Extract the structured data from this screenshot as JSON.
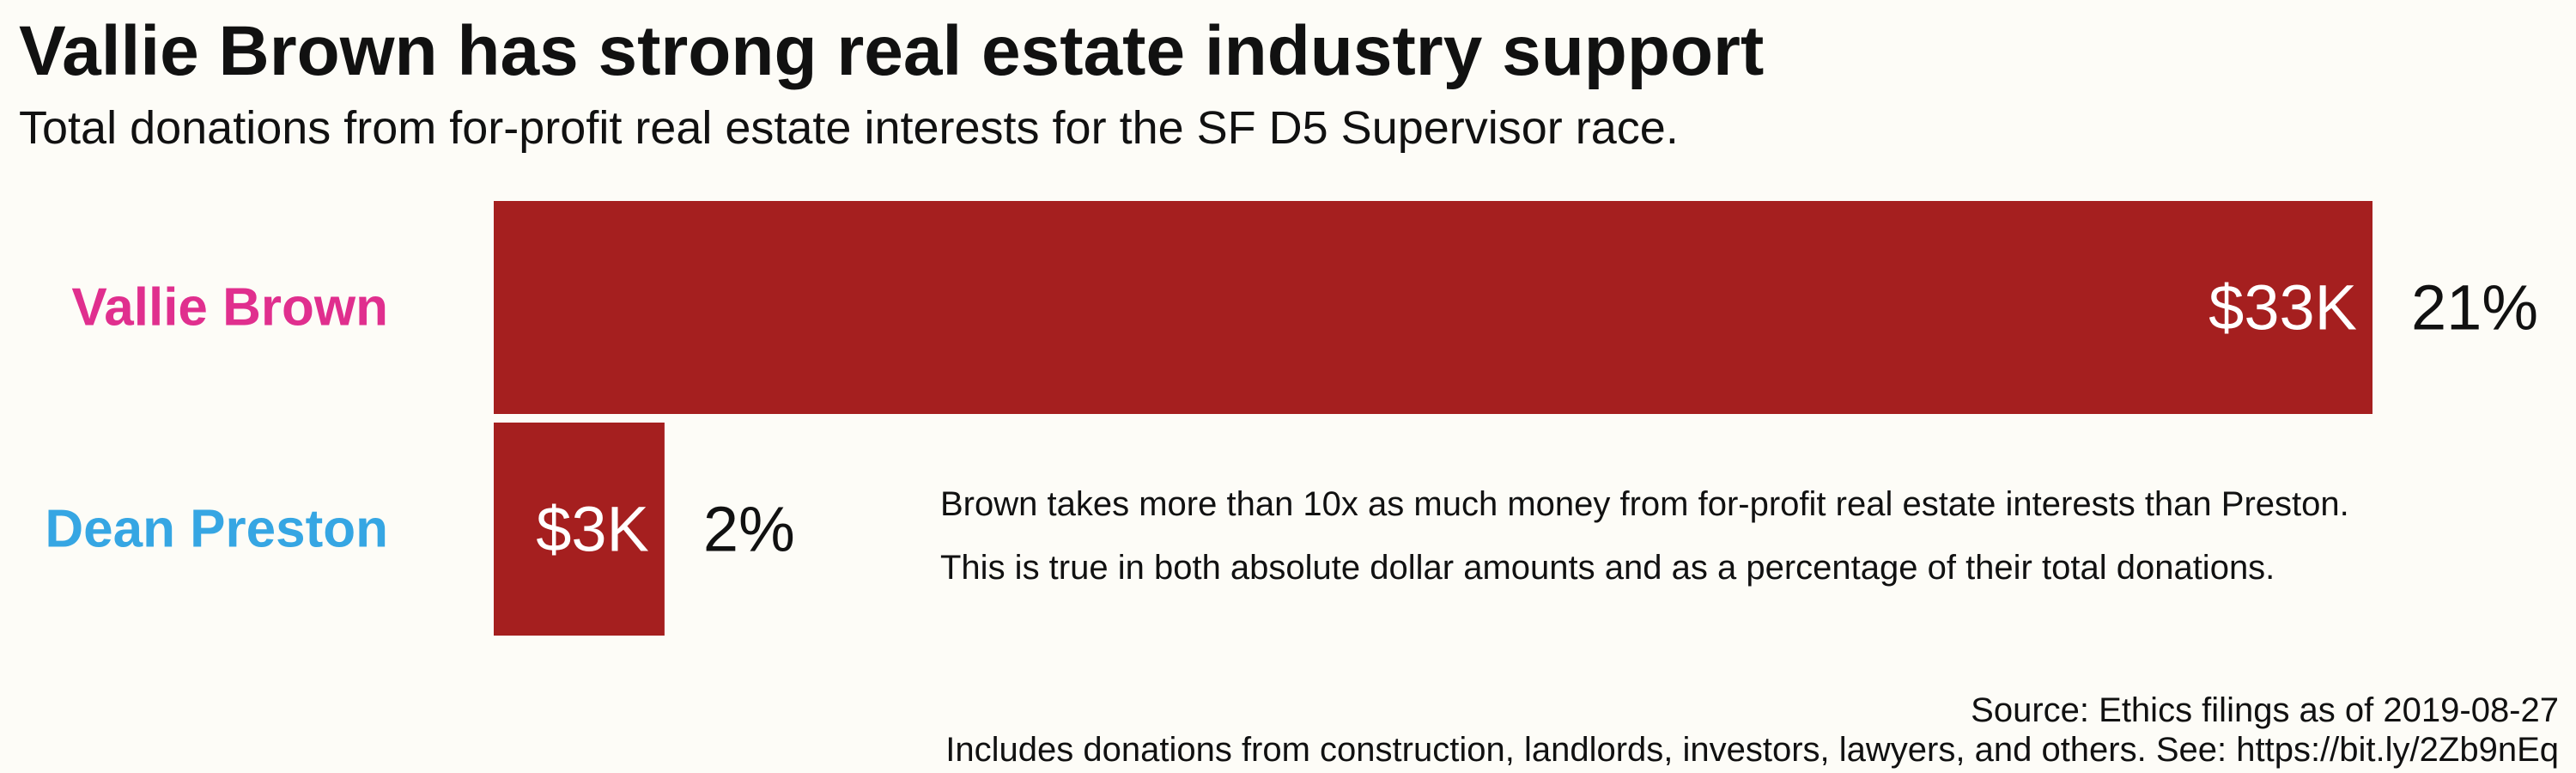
{
  "header": {
    "title": "Vallie Brown has strong real estate industry support",
    "subtitle": "Total donations from for-profit real estate interests for the SF D5 Supervisor race."
  },
  "annotation": {
    "line1": "Brown takes more than 10x as much money from for-profit real estate interests than Preston.",
    "line2": "This is true in both absolute dollar amounts and as a percentage of their total donations."
  },
  "footer": {
    "source": "Source: Ethics filings as of 2019-08-27",
    "note": "Includes donations from construction, landlords, investors, lawyers, and others. See: https://bit.ly/2Zb9nEq"
  },
  "colors": {
    "bar": "#a51f1f",
    "background": "#fdfcf7",
    "brown_label": "#e02f8e",
    "preston_label": "#36a6e3"
  },
  "chart_data": {
    "type": "bar",
    "orientation": "horizontal",
    "categories": [
      "Vallie Brown",
      "Dean Preston"
    ],
    "values": [
      33,
      3
    ],
    "value_labels": [
      "$33K",
      "$3K"
    ],
    "percent_labels": [
      "21%",
      "2%"
    ],
    "percent_values": [
      21,
      2
    ],
    "category_colors": [
      "#e02f8e",
      "#36a6e3"
    ],
    "unit": "thousand USD",
    "grid": false,
    "legend": "none"
  }
}
